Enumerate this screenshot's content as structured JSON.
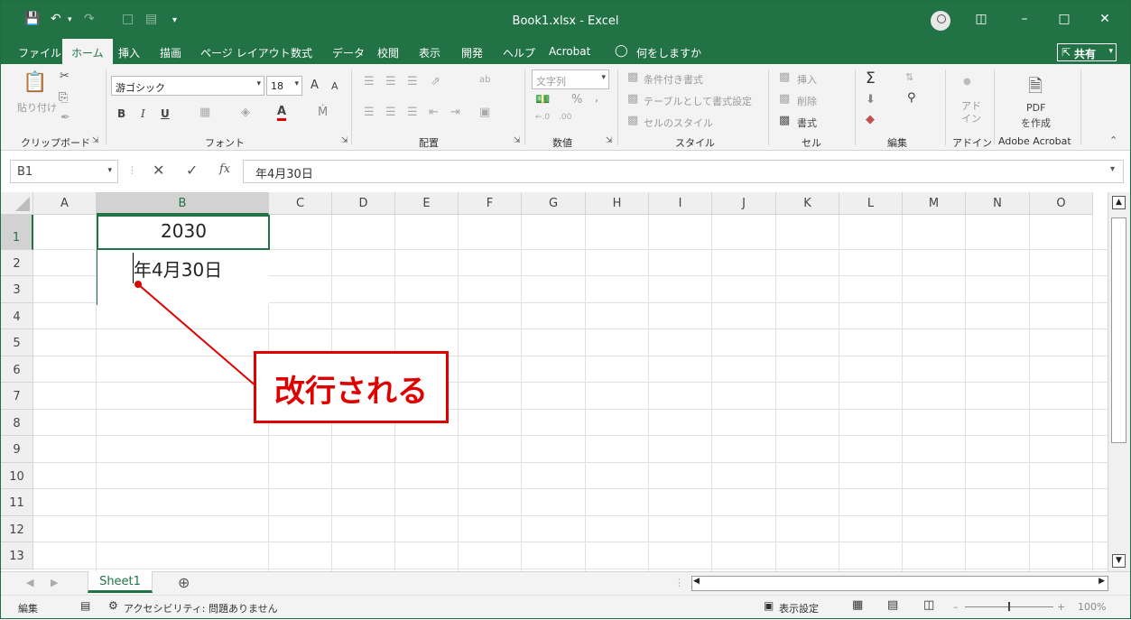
{
  "titlebar": {
    "title": "Book1.xlsx - Excel",
    "save_icon": "save-icon",
    "undo_icon": "undo-icon",
    "redo_icon": "redo-icon"
  },
  "menu": {
    "tabs": [
      "ファイル",
      "ホーム",
      "挿入",
      "描画",
      "ページ レイアウト",
      "数式",
      "データ",
      "校閲",
      "表示",
      "開発",
      "ヘルプ",
      "Acrobat"
    ],
    "active": "ホーム",
    "tell_me": "何をしますか",
    "share": "共有"
  },
  "ribbon": {
    "clipboard": {
      "label": "クリップボード",
      "paste": "貼り付け"
    },
    "font": {
      "label": "フォント",
      "name": "游ゴシック",
      "size": "18",
      "bold": "B",
      "italic": "I",
      "underline": "U",
      "grow": "A",
      "shrink": "A",
      "color_letter": "A"
    },
    "alignment": {
      "label": "配置"
    },
    "number": {
      "label": "数値",
      "format": "文字列",
      "percent": "%",
      "comma": ","
    },
    "styles": {
      "label": "スタイル",
      "conditional": "条件付き書式",
      "as_table": "テーブルとして書式設定",
      "cell_styles": "セルのスタイル"
    },
    "cells": {
      "label": "セル",
      "insert": "挿入",
      "delete": "削除",
      "format": "書式"
    },
    "editing": {
      "label": "編集",
      "sum": "Σ"
    },
    "addins": {
      "label": "アドイン",
      "button": "アド\nイン"
    },
    "acrobat": {
      "label": "Adobe Acrobat",
      "pdf_line1": "PDF",
      "pdf_line2": "を作成"
    }
  },
  "formula_bar": {
    "name_box": "B1",
    "cancel": "✕",
    "enter": "✓",
    "fx": "fx",
    "content": "年4月30日"
  },
  "grid": {
    "columns": [
      "A",
      "B",
      "C",
      "D",
      "E",
      "F",
      "G",
      "H",
      "I",
      "J",
      "K",
      "L",
      "M",
      "N",
      "O"
    ],
    "rows": [
      "1",
      "2",
      "3",
      "4",
      "5",
      "6",
      "7",
      "8",
      "9",
      "10",
      "11",
      "12",
      "13"
    ],
    "selected_column": "B",
    "selected_row": "1",
    "cell_b1_line1": "2030",
    "cell_b1_line2": "年4月30日"
  },
  "annotation": {
    "text": "改行される",
    "color": "#e00000"
  },
  "sheets": {
    "tabs": [
      "Sheet1"
    ],
    "add": "⊕"
  },
  "status": {
    "mode": "編集",
    "accessibility": "アクセシビリティ: 問題ありません",
    "display_settings": "表示設定",
    "zoom": "100%"
  },
  "colors": {
    "accent": "#217346"
  }
}
